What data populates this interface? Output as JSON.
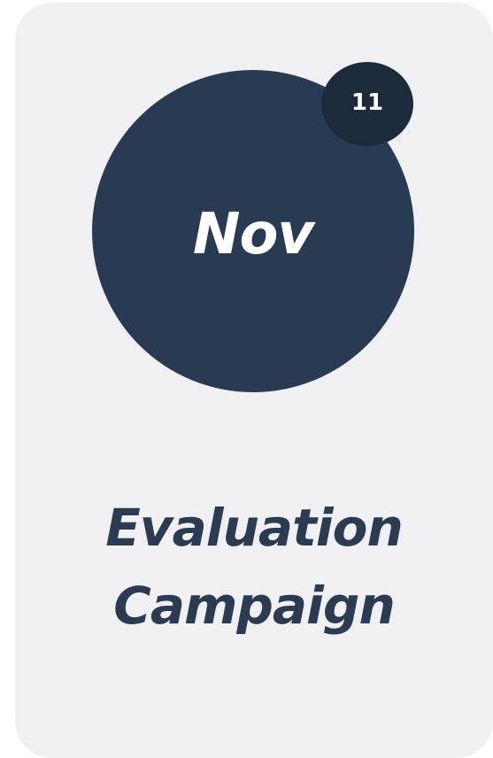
{
  "card": {
    "month": "Nov",
    "day": "11",
    "title_line_1": "Evaluation",
    "title_line_2": "Campaign"
  },
  "colors": {
    "card_background": "#f0f0f2",
    "circle": "#293b53",
    "badge": "#1c2b3c",
    "title_text": "#2a3b52",
    "circle_text": "#ffffff"
  }
}
